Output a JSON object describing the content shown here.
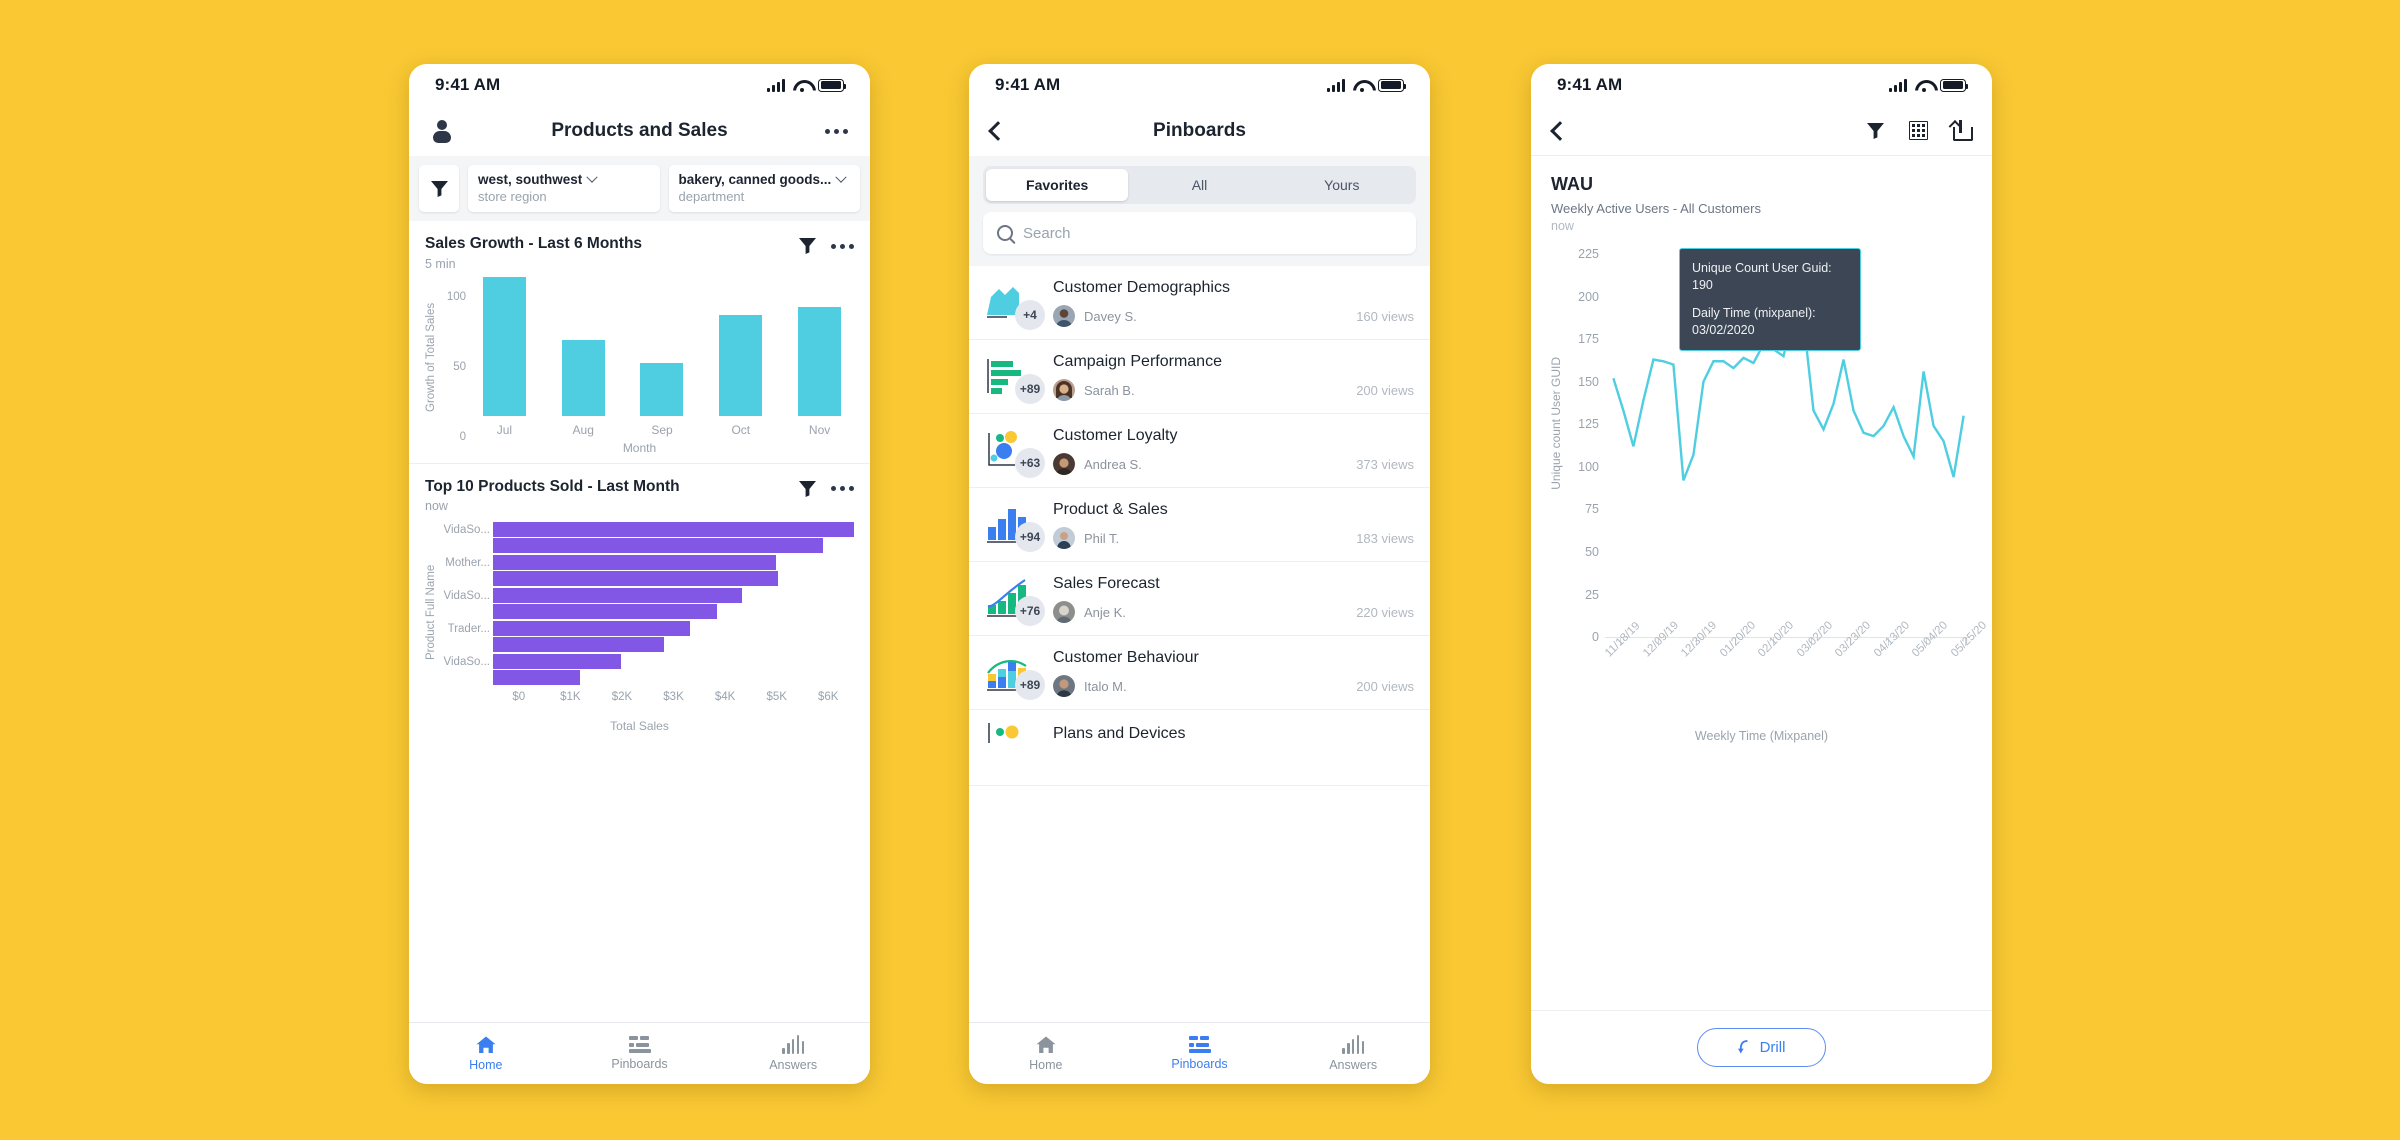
{
  "background_color": "#F9C833",
  "accent_blue": "#3B7EF0",
  "teal": "#4ECEE0",
  "purple": "#8257E6",
  "phone1": {
    "status": {
      "time": "9:41 AM"
    },
    "navbar": {
      "title": "Products and Sales",
      "profile_icon": "person-icon",
      "more_icon": "more-dots-icon"
    },
    "filters": {
      "filter_icon": "funnel-icon",
      "chips": [
        {
          "value": "west, southwest",
          "label": "store region"
        },
        {
          "value": "bakery, canned goods...",
          "label": "department"
        }
      ]
    },
    "cards": [
      {
        "title": "Sales Growth - Last 6 Months",
        "subtitle": "5 min",
        "filter_icon": "funnel-icon",
        "more_icon": "more-dots-icon"
      },
      {
        "title": "Top 10 Products Sold - Last Month",
        "subtitle": "now",
        "filter_icon": "funnel-icon",
        "more_icon": "more-dots-icon"
      }
    ],
    "tabs": [
      {
        "label": "Home",
        "icon": "home-icon",
        "active": true
      },
      {
        "label": "Pinboards",
        "icon": "pinboards-icon",
        "active": false
      },
      {
        "label": "Answers",
        "icon": "answers-icon",
        "active": false
      }
    ]
  },
  "phone2": {
    "status": {
      "time": "9:41 AM"
    },
    "navbar": {
      "title": "Pinboards",
      "back_icon": "chevron-left-icon"
    },
    "segments": [
      {
        "label": "Favorites",
        "active": true
      },
      {
        "label": "All",
        "active": false
      },
      {
        "label": "Yours",
        "active": false
      }
    ],
    "search": {
      "placeholder": "Search",
      "icon": "search-icon"
    },
    "list": [
      {
        "title": "Customer Demographics",
        "badge": "+4",
        "author": "Davey S.",
        "views": "160 views",
        "thumb": "area-chart-thumb"
      },
      {
        "title": "Campaign Performance",
        "badge": "+89",
        "author": "Sarah B.",
        "views": "200 views",
        "thumb": "horizontal-bar-chart-thumb"
      },
      {
        "title": "Customer Loyalty",
        "badge": "+63",
        "author": "Andrea S.",
        "views": "373 views",
        "thumb": "bubble-chart-thumb"
      },
      {
        "title": "Product & Sales",
        "badge": "+94",
        "author": "Phil T.",
        "views": "183 views",
        "thumb": "column-chart-thumb"
      },
      {
        "title": "Sales  Forecast",
        "badge": "+76",
        "author": "Anje K.",
        "views": "220 views",
        "thumb": "combo-chart-thumb"
      },
      {
        "title": "Customer Behaviour",
        "badge": "+89",
        "author": "Italo M.",
        "views": "200 views",
        "thumb": "stacked-chart-thumb"
      },
      {
        "title": "Plans and Devices",
        "badge": "",
        "author": "",
        "views": "",
        "thumb": "bubble-chart-thumb"
      }
    ],
    "tabs": [
      {
        "label": "Home",
        "icon": "home-icon",
        "active": false
      },
      {
        "label": "Pinboards",
        "icon": "pinboards-icon",
        "active": true
      },
      {
        "label": "Answers",
        "icon": "answers-icon",
        "active": false
      }
    ]
  },
  "phone3": {
    "status": {
      "time": "9:41 AM"
    },
    "navbar": {
      "back_icon": "chevron-left-icon",
      "filter_icon": "funnel-icon",
      "table_icon": "table-grid-icon",
      "share_icon": "share-icon"
    },
    "viz": {
      "title": "WAU",
      "subtitle": "Weekly Active Users - All Customers",
      "timestamp": "now"
    },
    "tooltip": {
      "metric_label": "Unique Count User Guid:",
      "metric_value": "190",
      "date_label": "Daily Time (mixpanel):",
      "date_value": "03/02/2020"
    },
    "drill": {
      "label": "Drill",
      "icon": "drill-arrow-icon"
    }
  },
  "chart_data": [
    {
      "type": "bar",
      "title": "Sales Growth - Last 6 Months",
      "subtitle": "5 min",
      "categories": [
        "Jul",
        "Aug",
        "Sep",
        "Oct",
        "Nov"
      ],
      "values": [
        104,
        54,
        38,
        72,
        78
      ],
      "xlabel": "Month",
      "ylabel": "Growth of Total Sales",
      "yticks": [
        0,
        50,
        100
      ],
      "ylim": [
        0,
        115
      ],
      "color": "#4ECEE0",
      "grid": false,
      "legend": "none"
    },
    {
      "type": "bar",
      "orientation": "horizontal",
      "title": "Top 10 Products Sold - Last Month",
      "subtitle": "now",
      "categories": [
        "VidaSo...",
        "",
        "Mother...",
        "",
        "VidaSo...",
        "",
        "Trader...",
        "",
        "VidaSo...",
        ""
      ],
      "values": [
        6000,
        5500,
        4700,
        4720,
        4150,
        3720,
        3280,
        2850,
        2120,
        1450
      ],
      "xlabel": "Total Sales",
      "ylabel": "Product Full Name",
      "xticks": [
        "$0",
        "$1K",
        "$2K",
        "$3K",
        "$4K",
        "$5K",
        "$6K"
      ],
      "xlim": [
        0,
        6000
      ],
      "color": "#8257E6",
      "grid": false,
      "legend": "none"
    },
    {
      "type": "line",
      "title": "WAU",
      "subtitle": "Weekly Active Users - All Customers",
      "xlabel": "Weekly Time (Mixpanel)",
      "ylabel": "Unique count User GUID",
      "yticks": [
        0,
        25,
        50,
        75,
        100,
        125,
        150,
        175,
        200,
        225
      ],
      "ylim": [
        0,
        235
      ],
      "xticks": [
        "11/18/19",
        "12/09/19",
        "12/30/19",
        "01/20/20",
        "02/10/20",
        "03/02/20",
        "03/23/20",
        "04/13/20",
        "05/04/20",
        "05/25/20"
      ],
      "color": "#4ECEE0",
      "grid": false,
      "legend": "none",
      "highlight_point": {
        "x": "03/02/2020",
        "y": 190
      },
      "values": [
        152,
        133,
        112,
        139,
        163,
        162,
        160,
        92,
        107,
        150,
        162,
        162,
        158,
        164,
        161,
        172,
        169,
        165,
        190,
        186,
        133,
        122,
        137,
        163,
        133,
        120,
        118,
        124,
        135,
        118,
        106,
        156,
        124,
        115,
        94,
        130
      ]
    }
  ]
}
